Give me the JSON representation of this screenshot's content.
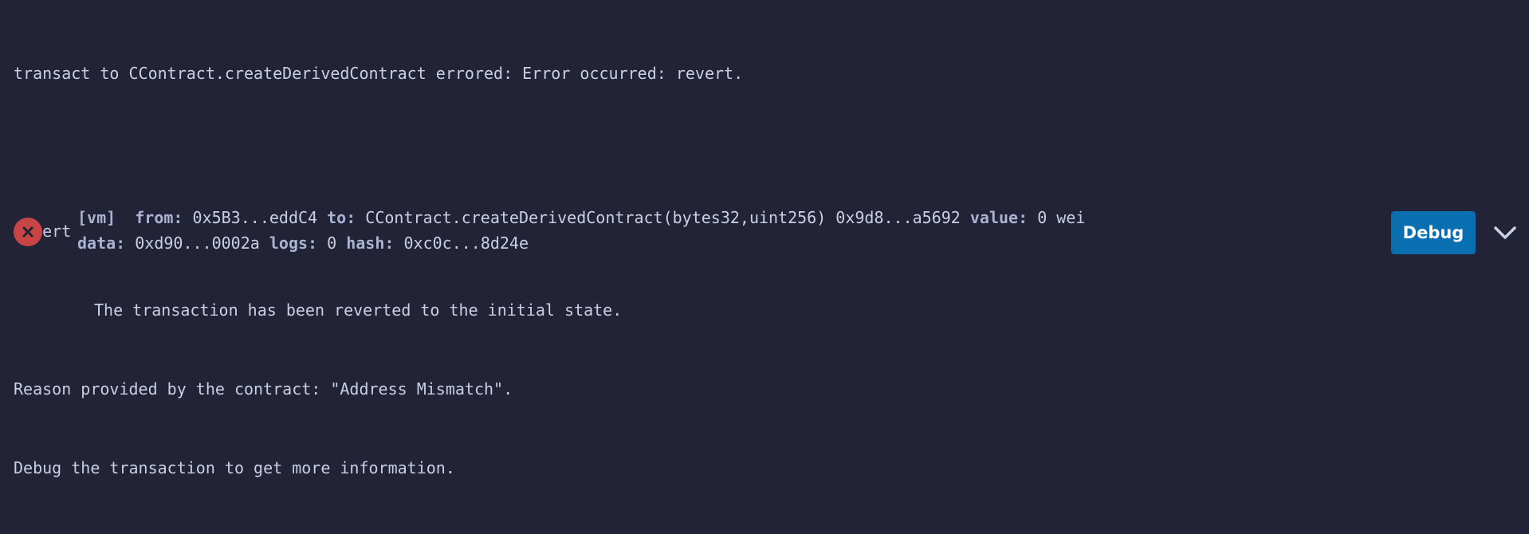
{
  "error": {
    "line1": "transact to CContract.createDerivedContract errored: Error occurred: revert.",
    "line2": "revert",
    "line3": "The transaction has been reverted to the initial state.",
    "line4": "Reason provided by the contract: \"Address Mismatch\".",
    "line5": "Debug the transaction to get more information."
  },
  "tx": {
    "vm_tag": "[vm]",
    "from_label": "from:",
    "from_value": "0x5B3...eddC4",
    "to_label": "to:",
    "to_value": "CContract.createDerivedContract(bytes32,uint256) 0x9d8...a5692",
    "value_label": "value:",
    "value_value": "0 wei",
    "data_label": "data:",
    "data_value": "0xd90...0002a",
    "logs_label": "logs:",
    "logs_value": "0",
    "hash_label": "hash:",
    "hash_value": "0xc0c...8d24e",
    "status_icon": "close-icon"
  },
  "actions": {
    "debug_label": "Debug",
    "expand_icon": "chevron-down-icon"
  },
  "colors": {
    "background": "#222336",
    "text": "#c9cfe4",
    "error": "#c84545",
    "debug_button": "#0a6fb0"
  }
}
